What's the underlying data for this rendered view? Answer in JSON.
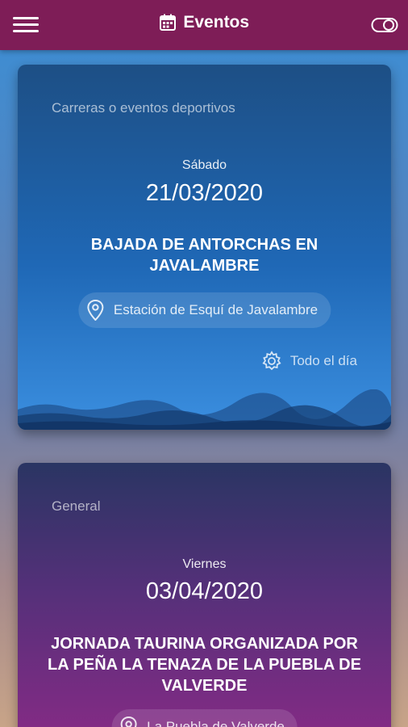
{
  "header": {
    "title": "Eventos",
    "menu_icon": "hamburger-menu-icon",
    "title_icon": "calendar-icon",
    "toggle_icon": "toggle-icon"
  },
  "events": [
    {
      "category": "Carreras o eventos deportivos",
      "day": "Sábado",
      "date": "21/03/2020",
      "title": "BAJADA DE ANTORCHAS EN JAVALAMBRE",
      "location": "Estación de Esquí de Javalambre",
      "time": "Todo el día",
      "color": "#1f68b6"
    },
    {
      "category": "General",
      "day": "Viernes",
      "date": "03/04/2020",
      "title": "JORNADA TAURINA ORGANIZADA POR LA PEÑA LA TENAZA DE LA PUEBLA DE VALVERDE",
      "location": "La Puebla de Valverde",
      "color": "#7a2a84"
    }
  ],
  "colors": {
    "appbar": "#7e1d57"
  }
}
